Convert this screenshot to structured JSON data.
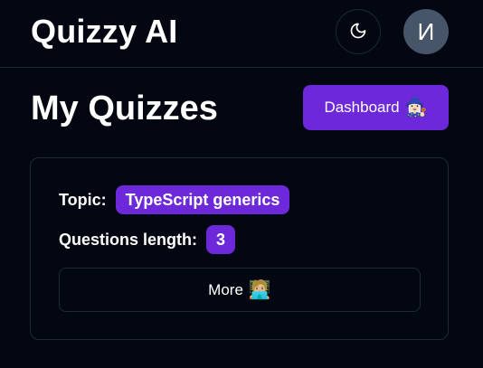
{
  "header": {
    "brand": "Quizzy AI",
    "theme_toggle_icon": "moon-icon",
    "avatar_initial": "И"
  },
  "page": {
    "title": "My Quizzes",
    "dashboard_button": {
      "label": "Dashboard",
      "emoji": "🧙🏻‍♀️"
    }
  },
  "quiz_card": {
    "topic_label": "Topic:",
    "topic_value": "TypeScript generics",
    "questions_label": "Questions length:",
    "questions_value": "3",
    "more_button": {
      "label": "More",
      "emoji": "🧑🏼‍💻"
    }
  },
  "colors": {
    "background": "#030711",
    "accent": "#6d28d9",
    "border": "#1f2937",
    "avatar_bg": "#475569"
  }
}
